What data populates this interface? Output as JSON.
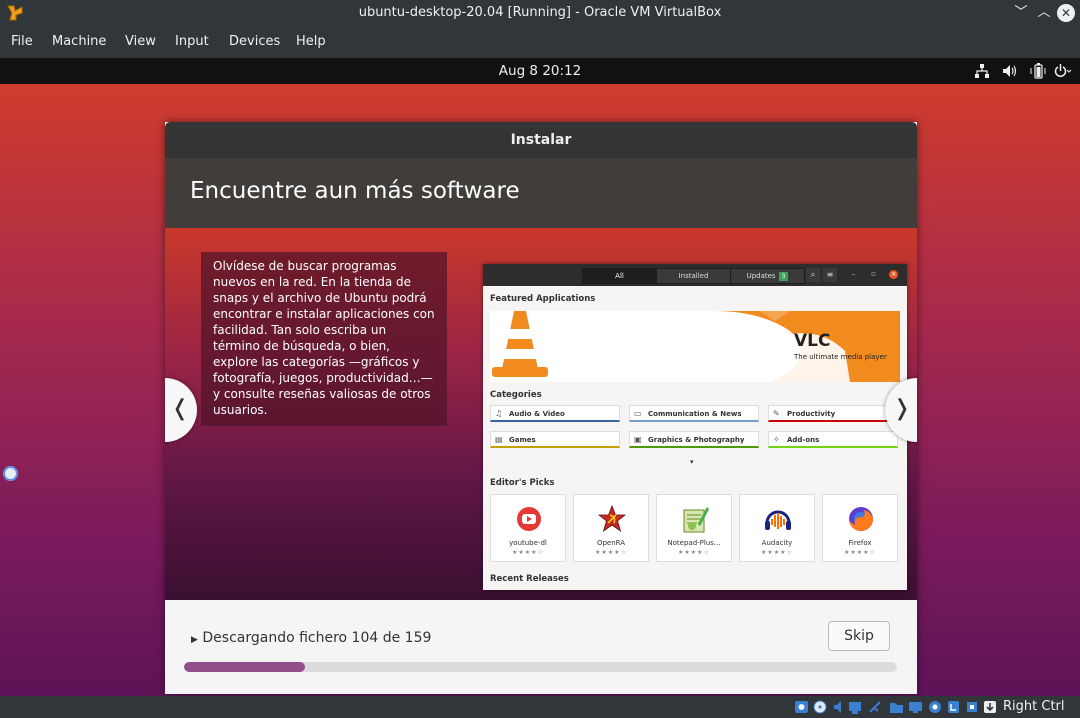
{
  "host": {
    "window_title": "ubuntu-desktop-20.04 [Running] - Oracle VM VirtualBox",
    "menu": [
      "File",
      "Machine",
      "View",
      "Input",
      "Devices",
      "Help"
    ],
    "host_key": "Right Ctrl",
    "status_icons": [
      "hard-disk-icon",
      "optical-drive-icon",
      "audio-icon",
      "network-icon",
      "usb-icon",
      "shared-folder-icon",
      "display-icon",
      "recording-icon",
      "video-capture-icon",
      "cpu-icon",
      "arrow-down-icon"
    ]
  },
  "guest": {
    "clock": "Aug 8  20:12",
    "tray_icons": [
      "network-wired-icon",
      "volume-icon",
      "battery-icon",
      "power-menu-icon"
    ]
  },
  "installer": {
    "header_title": "Instalar",
    "slide_title": "Encuentre aun más software",
    "slide_text": "Olvídese de buscar programas nuevos en la red. En la tienda de snaps y el archivo de Ubuntu podrá encontrar e instalar aplicaciones con facilidad. Tan solo escriba un término de búsqueda, o bien, explore las categorías —gráficos y fotografía, juegos, productividad…— y consulte reseñas valiosas de otros usuarios.",
    "prev_symbol": "❬",
    "next_symbol": "❭",
    "progress_text": "Descargando fichero 104 de 159",
    "progress_current": 104,
    "progress_total": 159,
    "skip_label": "Skip",
    "accent_color": "#924d8b"
  },
  "software_center": {
    "tabs": [
      "All",
      "Installed",
      "Updates"
    ],
    "updates_count": "3",
    "featured_label": "Featured Applications",
    "featured_app": "VLC",
    "featured_tagline": "The ultimate media player",
    "categories_label": "Categories",
    "categories": [
      {
        "name": "Audio & Video",
        "icon": "music-note-icon",
        "color": "#3465a4"
      },
      {
        "name": "Communication & News",
        "icon": "chat-icon",
        "color": "#729fcf"
      },
      {
        "name": "Productivity",
        "icon": "pencil-icon",
        "color": "#cc0000"
      },
      {
        "name": "Games",
        "icon": "gamepad-icon",
        "color": "#c4a000"
      },
      {
        "name": "Graphics & Photography",
        "icon": "image-icon",
        "color": "#4e9a06"
      },
      {
        "name": "Add-ons",
        "icon": "puzzle-icon",
        "color": "#73d216"
      }
    ],
    "picks_label": "Editor's Picks",
    "picks": [
      {
        "name": "youtube-dl",
        "rating": "★★★★☆"
      },
      {
        "name": "OpenRA",
        "rating": "★★★★☆"
      },
      {
        "name": "Notepad-Plus...",
        "rating": "★★★★☆"
      },
      {
        "name": "Audacity",
        "rating": "★★★★☆"
      },
      {
        "name": "Firefox",
        "rating": "★★★★☆"
      }
    ],
    "recent_label": "Recent Releases"
  }
}
